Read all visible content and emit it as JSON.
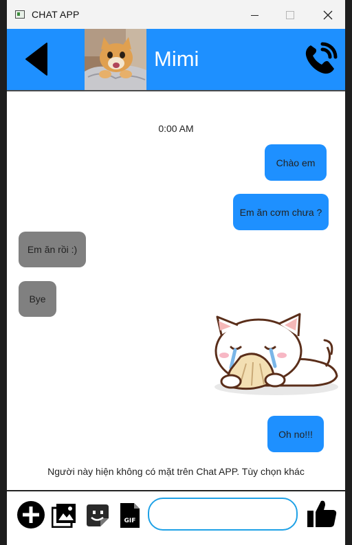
{
  "window": {
    "title": "CHAT APP"
  },
  "header": {
    "contact_name": "Mimi",
    "accent_color": "#1e90ff"
  },
  "chat": {
    "timestamp": "0:00 AM",
    "messages": [
      {
        "direction": "out",
        "text": "Chào em"
      },
      {
        "direction": "out",
        "text": "Em ăn cơm chưa ?"
      },
      {
        "direction": "in",
        "text": "Em ăn rồi :)"
      },
      {
        "direction": "in",
        "text": "Bye"
      },
      {
        "direction": "out",
        "type": "sticker",
        "sticker": "crying-cat-sticker"
      },
      {
        "direction": "out",
        "text": "Oh no!!!"
      }
    ],
    "notice": "Người này hiện không có mặt trên Chat APP. Tùy chọn khác"
  },
  "input_bar": {
    "icons": [
      "add-icon",
      "image-icon",
      "sticker-icon",
      "gif-icon",
      "thumbs-up-icon"
    ],
    "gif_label": "GIF",
    "message_value": "",
    "message_placeholder": ""
  },
  "icons": {
    "back": "back-arrow-icon",
    "call": "phone-call-icon",
    "minimize": "minimize-icon",
    "maximize": "maximize-icon",
    "close": "close-icon"
  }
}
